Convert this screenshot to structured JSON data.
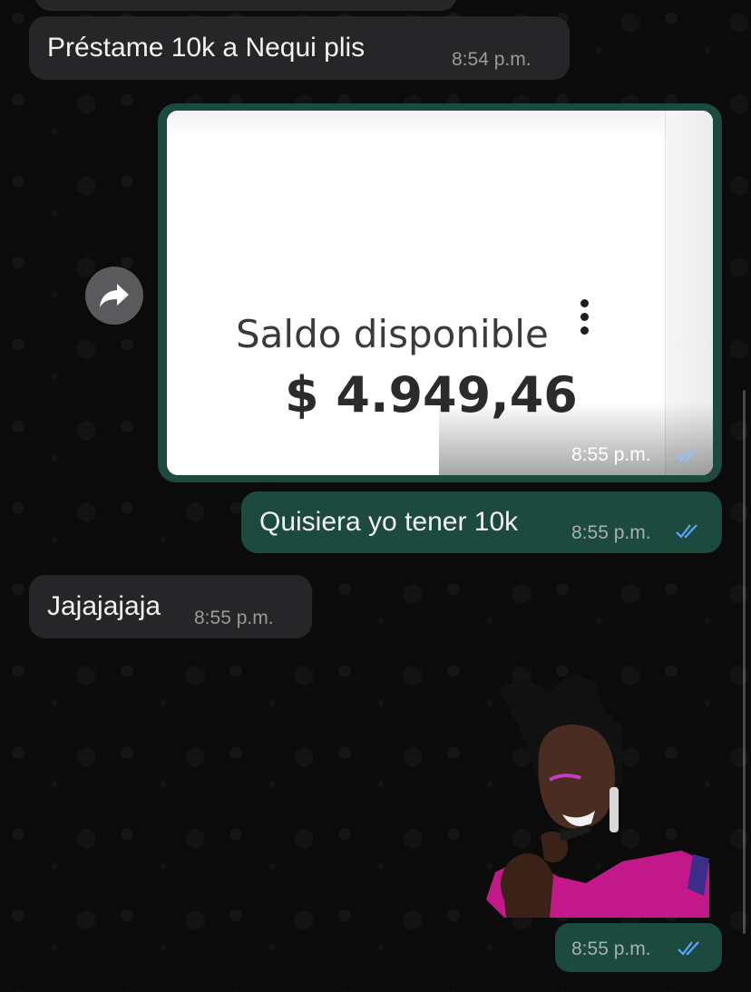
{
  "chat": {
    "messages": [
      {
        "text": "Préstame 10k a Nequi plis",
        "time": "8:54 p.m."
      },
      {
        "type": "image",
        "time": "8:55 p.m.",
        "image_text": {
          "label": "Saldo disponible",
          "amount": "$ 4.949,46"
        }
      },
      {
        "text": "Quisiera yo tener 10k",
        "time": "8:55 p.m."
      },
      {
        "text": "Jajajajaja",
        "time": "8:55 p.m."
      },
      {
        "type": "sticker",
        "time": "8:55 p.m."
      }
    ]
  },
  "icons": {
    "forward": "forward-arrow-icon",
    "read_receipt": "double-check-icon",
    "menu": "vertical-dots-icon"
  },
  "colors": {
    "incoming_bubble": "#262628",
    "outgoing_bubble": "#1c4a3e",
    "read_tick": "#5aa7ff"
  }
}
